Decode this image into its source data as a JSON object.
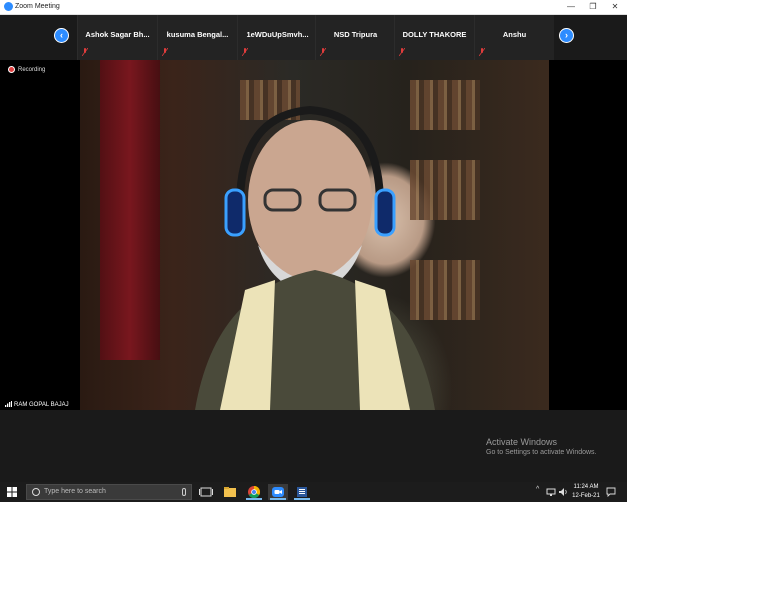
{
  "window": {
    "title": "Zoom Meeting",
    "controls": {
      "minimize": "—",
      "maximize": "❐",
      "close": "✕"
    }
  },
  "participants_strip": {
    "prev_icon": "‹",
    "next_icon": "›",
    "participants": [
      {
        "name": "Ashok Sagar Bh..."
      },
      {
        "name": "kusuma  Bengal..."
      },
      {
        "name": "1eWDuUpSmvh..."
      },
      {
        "name": "NSD Tripura"
      },
      {
        "name": "DOLLY THAKORE"
      },
      {
        "name": "Anshu"
      }
    ]
  },
  "main_video": {
    "recording_label": "Recording",
    "speaker_name": "RAM GOPAL BAJAJ"
  },
  "watermark": {
    "title": "Activate Windows",
    "subtitle": "Go to Settings to activate Windows."
  },
  "taskbar": {
    "search_placeholder": "Type here to search",
    "clock_time": "11:24 AM",
    "clock_date": "12-Feb-21",
    "tray_chevron": "^"
  },
  "colors": {
    "accent": "#2d8cff",
    "background": "#1a1a1a",
    "muted_mic": "#e03c3c"
  }
}
